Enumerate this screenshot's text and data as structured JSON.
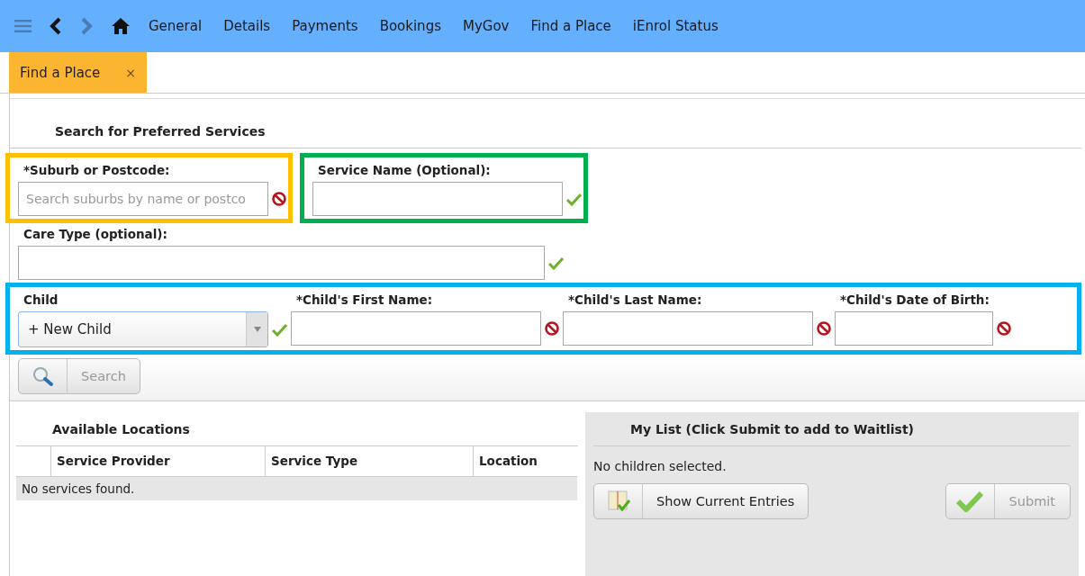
{
  "nav": {
    "items": [
      {
        "label": "General"
      },
      {
        "label": "Details"
      },
      {
        "label": "Payments"
      },
      {
        "label": "Bookings"
      },
      {
        "label": "MyGov"
      },
      {
        "label": "Find a Place"
      },
      {
        "label": "iEnrol Status"
      }
    ]
  },
  "tabs": [
    {
      "label": "Find a Place",
      "selected": true,
      "close": "×"
    }
  ],
  "search_form": {
    "title": "Search for Preferred Services",
    "rows": [
      {
        "groups": [
          {
            "color": "#ffc000",
            "fields": [
              {
                "kind": "text",
                "label": "*Suburb or Postcode:",
                "placeholder": "Search suburbs by name or postco",
                "valid": false
              }
            ]
          },
          {
            "color": "#00b050",
            "fields": [
              {
                "kind": "text",
                "label": "Service Name (Optional):",
                "valid": true
              }
            ]
          }
        ]
      },
      {
        "groups": [
          {
            "fields": [
              {
                "kind": "text",
                "label": "Care Type (optional):",
                "valid": true
              }
            ]
          }
        ]
      },
      {
        "groups": [
          {
            "color": "#00b0f0",
            "fields": [
              {
                "kind": "select",
                "label": "Child",
                "value": "+ New Child",
                "valid": true
              },
              {
                "kind": "text",
                "label": "*Child's First Name:",
                "valid": false
              },
              {
                "kind": "text",
                "label": "*Child's Last Name:",
                "valid": false
              },
              {
                "kind": "text",
                "label": "*Child's Date of Birth:",
                "valid": false
              }
            ]
          }
        ]
      }
    ],
    "search_button": {
      "label": "Search",
      "disabled": true
    }
  },
  "available_locations": {
    "title": "Available Locations",
    "columns": [
      "Service Provider",
      "Service Type",
      "Location"
    ],
    "empty_message": "No services found."
  },
  "my_list": {
    "title": "My List (Click Submit to add to Waitlist)",
    "message": "No children selected.",
    "buttons": [
      {
        "kind": "entries",
        "label": "Show Current Entries",
        "disabled": false
      },
      {
        "kind": "submit",
        "label": "Submit",
        "disabled": true
      }
    ]
  }
}
